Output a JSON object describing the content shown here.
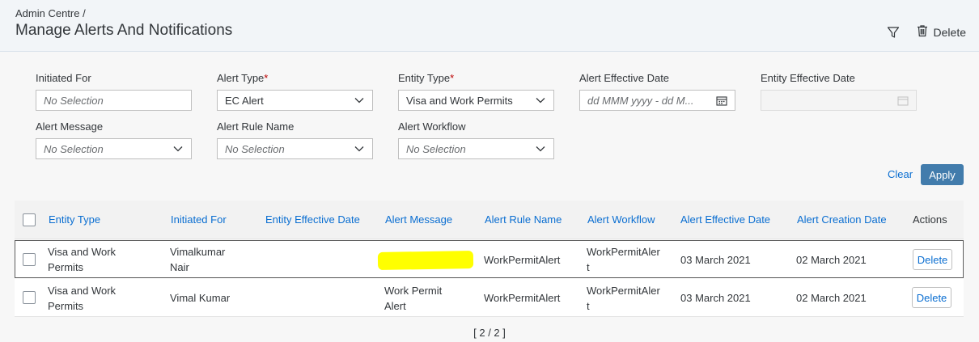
{
  "header": {
    "breadcrumb": "Admin Centre /",
    "title": "Manage Alerts And Notifications",
    "delete_label": "Delete",
    "icons": [
      "filter-icon",
      "trash-icon"
    ]
  },
  "filters": {
    "initiated_for": {
      "label": "Initiated For",
      "placeholder": "No Selection"
    },
    "alert_type": {
      "label": "Alert Type",
      "required": "*",
      "value": "EC Alert"
    },
    "entity_type": {
      "label": "Entity Type",
      "required": "*",
      "value": "Visa and Work Permits"
    },
    "alert_effective_date": {
      "label": "Alert Effective Date",
      "placeholder": "dd MMM yyyy - dd M..."
    },
    "entity_effective_date": {
      "label": "Entity Effective Date",
      "value": ""
    },
    "alert_message": {
      "label": "Alert Message",
      "placeholder": "No Selection"
    },
    "alert_rule_name": {
      "label": "Alert Rule Name",
      "placeholder": "No Selection"
    },
    "alert_workflow": {
      "label": "Alert Workflow",
      "placeholder": "No Selection"
    },
    "clear_label": "Clear",
    "apply_label": "Apply"
  },
  "table": {
    "columns": [
      "Entity Type",
      "Initiated For",
      "Entity Effective Date",
      "Alert Message",
      "Alert Rule Name",
      "Alert Workflow",
      "Alert Effective Date",
      "Alert Creation Date",
      "Actions"
    ],
    "rows": [
      {
        "entity_type": [
          "Visa and Work",
          "Permits"
        ],
        "initiated_for": [
          "Vimalkumar",
          "Nair"
        ],
        "entity_effective_date": "",
        "alert_message": "",
        "alert_rule_name": "WorkPermitAlert",
        "alert_workflow": [
          "WorkPermitAler",
          "t"
        ],
        "alert_effective_date": "03 March 2021",
        "alert_creation_date": "02 March 2021",
        "action": "Delete"
      },
      {
        "entity_type": [
          "Visa and Work",
          "Permits"
        ],
        "initiated_for": [
          "Vimal Kumar"
        ],
        "entity_effective_date": "",
        "alert_message": [
          "Work Permit",
          "Alert"
        ],
        "alert_rule_name": "WorkPermitAlert",
        "alert_workflow": [
          "WorkPermitAler",
          "t"
        ],
        "alert_effective_date": "03 March 2021",
        "alert_creation_date": "02 March 2021",
        "action": "Delete"
      }
    ]
  },
  "pager": "[ 2 / 2 ]",
  "colors": {
    "link": "#0a6ed1",
    "apply_bg": "#427cac",
    "required": "#bb0000",
    "redaction": "#ffff00"
  }
}
